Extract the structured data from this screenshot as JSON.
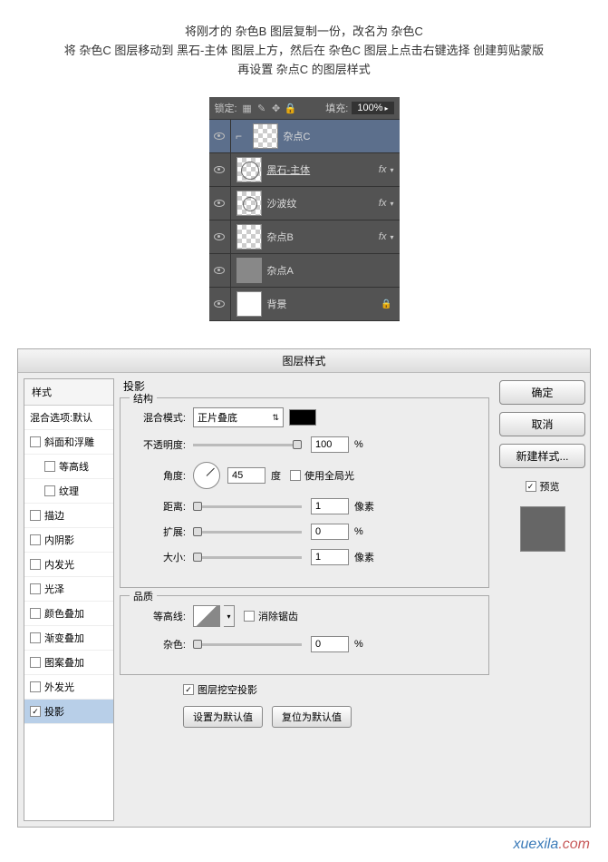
{
  "instructions": {
    "line1": "将刚才的 杂色B 图层复制一份，改名为 杂色C",
    "line2": "将 杂色C 图层移动到 黑石-主体 图层上方，然后在 杂色C 图层上点击右键选择 创建剪贴蒙版",
    "line3": "再设置 杂点C 的图层样式"
  },
  "layersPanel": {
    "lockLabel": "锁定:",
    "fillLabel": "填充:",
    "fillValue": "100%",
    "layers": [
      {
        "name": "杂点C",
        "fx": false,
        "selected": true,
        "indent": true,
        "thumb": "checker"
      },
      {
        "name": "黑石-主体",
        "fx": true,
        "underline": true,
        "thumb": "checker-circle"
      },
      {
        "name": "沙波纹",
        "fx": true,
        "thumb": "checker-spiral"
      },
      {
        "name": "杂点B",
        "fx": true,
        "thumb": "checker"
      },
      {
        "name": "杂点A",
        "fx": false,
        "thumb": "gray"
      },
      {
        "name": "背景",
        "fx": false,
        "locked": true,
        "thumb": "white"
      }
    ]
  },
  "dialog": {
    "title": "图层样式",
    "styleList": {
      "header": "样式",
      "blendOptions": "混合选项:默认",
      "items": [
        {
          "label": "斜面和浮雕",
          "checked": false
        },
        {
          "label": "等高线",
          "checked": false,
          "indent": true
        },
        {
          "label": "纹理",
          "checked": false,
          "indent": true
        },
        {
          "label": "描边",
          "checked": false
        },
        {
          "label": "内阴影",
          "checked": false
        },
        {
          "label": "内发光",
          "checked": false
        },
        {
          "label": "光泽",
          "checked": false
        },
        {
          "label": "颜色叠加",
          "checked": false
        },
        {
          "label": "渐变叠加",
          "checked": false
        },
        {
          "label": "图案叠加",
          "checked": false
        },
        {
          "label": "外发光",
          "checked": false
        },
        {
          "label": "投影",
          "checked": true,
          "selected": true
        }
      ]
    },
    "content": {
      "title": "投影",
      "structure": {
        "label": "结构",
        "blendModeLabel": "混合模式:",
        "blendModeValue": "正片叠底",
        "opacityLabel": "不透明度:",
        "opacityValue": "100",
        "opacityUnit": "%",
        "angleLabel": "角度:",
        "angleValue": "45",
        "angleUnit": "度",
        "globalLightLabel": "使用全局光",
        "distanceLabel": "距离:",
        "distanceValue": "1",
        "distanceUnit": "像素",
        "spreadLabel": "扩展:",
        "spreadValue": "0",
        "spreadUnit": "%",
        "sizeLabel": "大小:",
        "sizeValue": "1",
        "sizeUnit": "像素"
      },
      "quality": {
        "label": "品质",
        "contourLabel": "等高线:",
        "antiAliasLabel": "消除锯齿",
        "noiseLabel": "杂色:",
        "noiseValue": "0",
        "noiseUnit": "%"
      },
      "knockoutLabel": "图层挖空投影",
      "setDefaultBtn": "设置为默认值",
      "resetDefaultBtn": "复位为默认值"
    },
    "buttons": {
      "ok": "确定",
      "cancel": "取消",
      "newStyle": "新建样式...",
      "preview": "预览"
    }
  },
  "watermark": {
    "text1": "xuexila",
    "text2": ".com"
  }
}
